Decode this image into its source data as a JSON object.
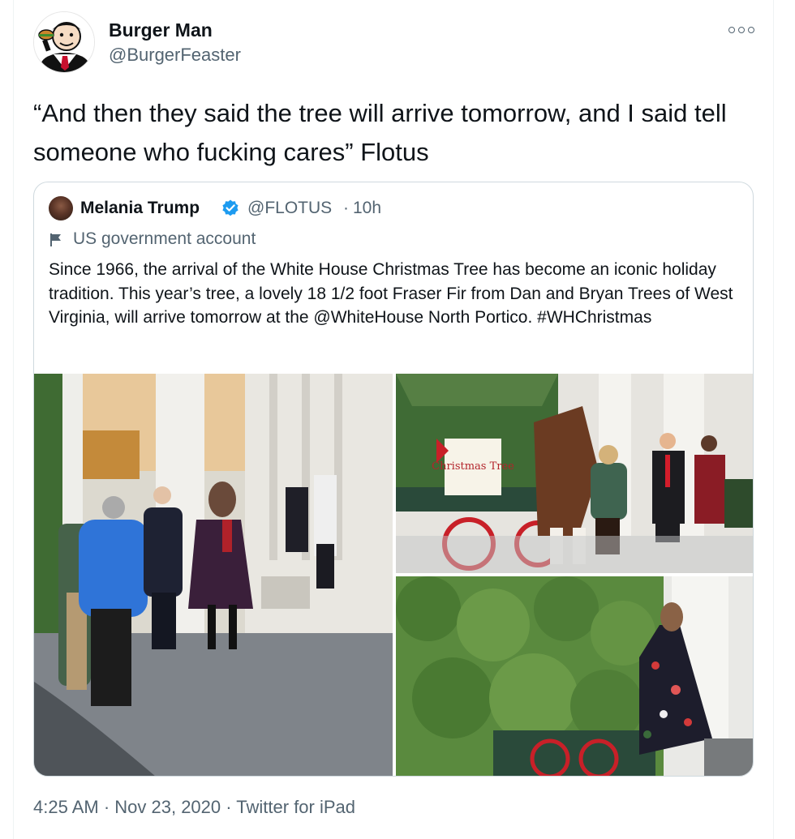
{
  "tweet": {
    "author": {
      "name": "Burger Man",
      "handle": "@BurgerFeaster"
    },
    "text": "“And then they said the tree will arrive tomorrow, and I said tell someone who fucking cares” Flotus",
    "timestamp": "4:25 AM · Nov 23, 2020 · Twitter for iPad"
  },
  "quoted_tweet": {
    "name": "Melania Trump",
    "handle": "@FLOTUS",
    "separator": "·",
    "time": "10h",
    "label": "US government account",
    "text": "Since 1966, the arrival of the White House Christmas Tree has become an iconic holiday tradition. This year’s tree, a lovely 18 1/2 foot Fraser Fir from Dan and Bryan Trees of West Virginia, will arrive tomorrow at the @WhiteHouse North Portico. #WHChristmas",
    "sign_text": "Christmas Tree"
  },
  "colors": {
    "verified": "#1d9bf0",
    "secondary_text": "#536471",
    "border": "#cfd9de"
  },
  "icons": [
    "more-icon",
    "verified-icon",
    "flag-icon"
  ]
}
